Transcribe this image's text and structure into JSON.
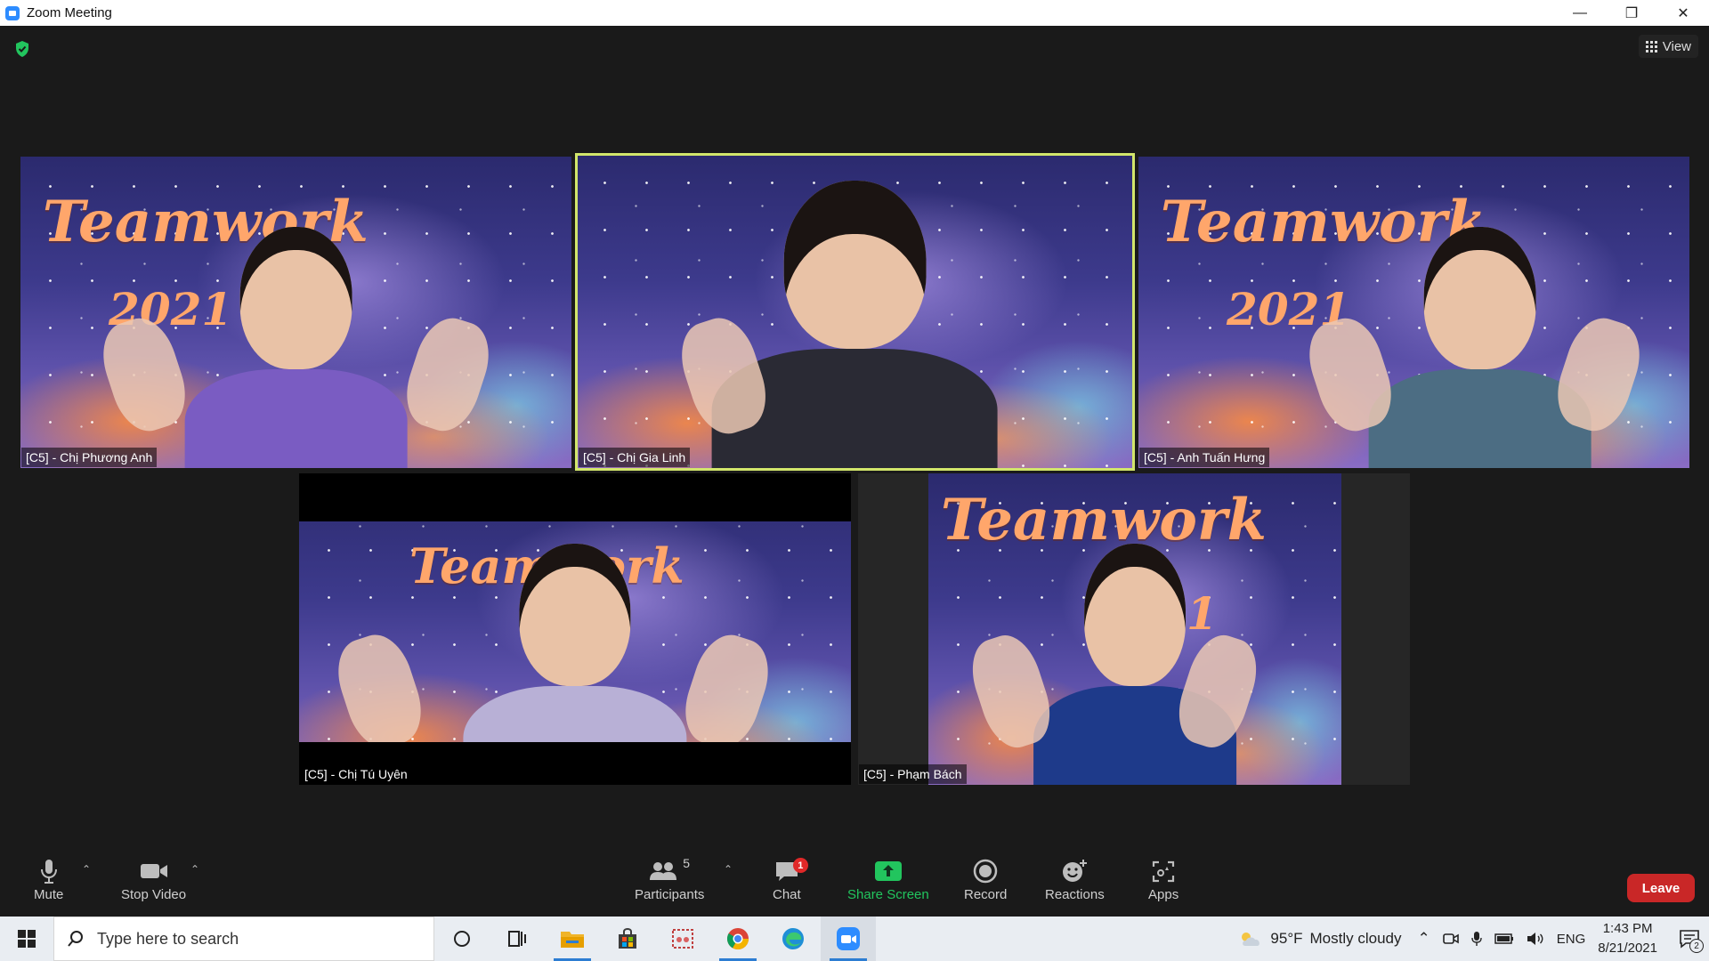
{
  "window": {
    "title": "Zoom Meeting",
    "controls": {
      "minimize": "—",
      "restore": "❐",
      "close": "✕"
    }
  },
  "meeting": {
    "view_label": "View",
    "background_text": {
      "word": "Teamwork",
      "year": "2021"
    },
    "participants": [
      {
        "name": "[C5] - Chị Phương Anh",
        "shirt": "#7a5cc2",
        "active": false
      },
      {
        "name": "[C5] - Chị Gia Linh",
        "shirt": "#2a2a34",
        "active": true
      },
      {
        "name": "[C5] - Anh Tuấn Hưng",
        "shirt": "#4c6d83",
        "active": false
      },
      {
        "name": "[C5] - Chị Tú Uyên",
        "shirt": "#b8b0d6",
        "active": false
      },
      {
        "name": "[C5] - Phạm Bách",
        "shirt": "#1e3a8a",
        "active": false
      }
    ],
    "active_speaker_color": "#d2e66b"
  },
  "toolbar": {
    "mute_label": "Mute",
    "stop_video_label": "Stop Video",
    "participants_label": "Participants",
    "participants_count": "5",
    "chat_label": "Chat",
    "chat_badge": "1",
    "share_screen_label": "Share Screen",
    "record_label": "Record",
    "reactions_label": "Reactions",
    "apps_label": "Apps",
    "leave_label": "Leave",
    "share_color": "#22c55e",
    "leave_color": "#c92727"
  },
  "taskbar": {
    "search_placeholder": "Type here to search",
    "weather_temp": "95°F",
    "weather_desc": "Mostly cloudy",
    "language": "ENG",
    "time": "1:43 PM",
    "date": "8/21/2021",
    "notification_count": "2"
  }
}
